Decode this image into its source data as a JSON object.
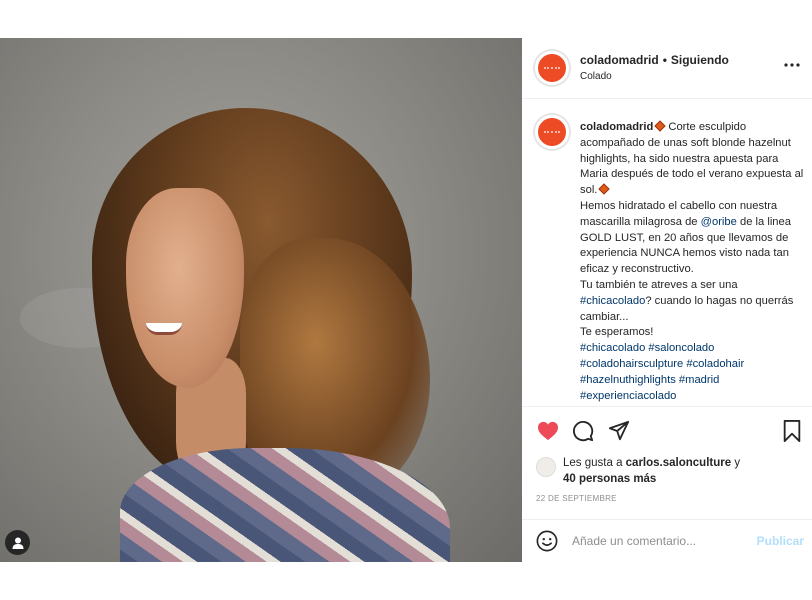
{
  "post": {
    "username": "coladomadrid",
    "separator": "•",
    "follow_status": "Siguiendo",
    "location": "Colado",
    "more_icon": "more-horizontal-icon",
    "caption": {
      "username": "coladomadrid",
      "p1": "Corte esculpido acompañado de unas soft blonde hazelnut highlights, ha sido nuestra apuesta para Maria después de todo el verano expuesta al sol.",
      "p2a": "Hemos hidratado el cabello con nuestra mascarilla milagrosa de ",
      "mention": "@oribe",
      "p2b": " de la linea GOLD LUST, en 20 años que llevamos de experiencia NUNCA hemos visto nada tan eficaz y reconstructivo.",
      "p3a": "Tu también te atreves a ser una ",
      "p3tag": "#chicacolado",
      "p3b": "? cuando lo hagas no querrás cambiar...",
      "p4": "Te esperamos!",
      "hashtags": [
        "#chicacolado",
        "#saloncolado",
        "#coladohairsculpture",
        "#coladohair",
        "#hazelnuthighlights",
        "#madrid",
        "#experienciacolado"
      ]
    },
    "likes": {
      "prefix": "Les gusta a ",
      "user": "carlos.salonculture",
      "middle": " y",
      "others": "40 personas más"
    },
    "date": "22 DE SEPTIEMBRE",
    "comment_placeholder": "Añade un comentario...",
    "publish_label": "Publicar"
  },
  "colors": {
    "brand": "#ec4b26",
    "like": "#ed4956",
    "link": "#00376b",
    "publish_disabled": "#b2dffc"
  }
}
